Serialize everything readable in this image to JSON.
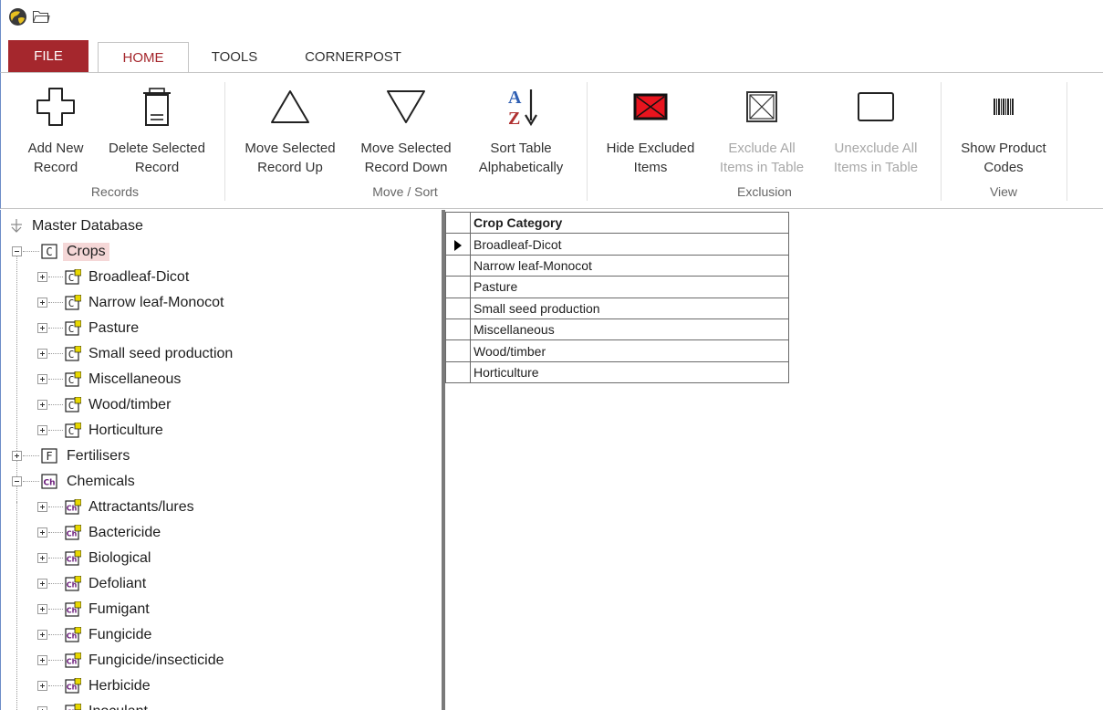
{
  "tabs": [
    {
      "id": "file",
      "label": "FILE"
    },
    {
      "id": "home",
      "label": "HOME"
    },
    {
      "id": "tools",
      "label": "TOOLS"
    },
    {
      "id": "cornerpost",
      "label": "CORNERPOST"
    }
  ],
  "ribbon": {
    "groups": [
      {
        "label": "Records"
      },
      {
        "label": "Move / Sort"
      },
      {
        "label": "Exclusion"
      },
      {
        "label": "View"
      }
    ],
    "buttons": [
      {
        "line1": "Add New",
        "line2": "Record"
      },
      {
        "line1": "Delete Selected",
        "line2": "Record"
      },
      {
        "line1": "Move Selected",
        "line2": "Record Up"
      },
      {
        "line1": "Move Selected",
        "line2": "Record Down"
      },
      {
        "line1": "Sort Table",
        "line2": "Alphabetically"
      },
      {
        "line1": "Hide Excluded",
        "line2": "Items"
      },
      {
        "line1": "Exclude All",
        "line2": "Items in Table"
      },
      {
        "line1": "Unexclude All",
        "line2": "Items in Table"
      },
      {
        "line1": "Show Product",
        "line2": "Codes"
      }
    ],
    "sort_glyph": {
      "a": "A",
      "z": "Z"
    }
  },
  "tree": {
    "root": "Master Database",
    "crops": {
      "label": "Crops",
      "icon_letter": "C",
      "children": [
        "Broadleaf-Dicot",
        "Narrow leaf-Monocot",
        "Pasture",
        "Small seed production",
        "Miscellaneous",
        "Wood/timber",
        "Horticulture"
      ]
    },
    "fertilisers": {
      "label": "Fertilisers",
      "icon_letter": "F"
    },
    "chemicals": {
      "label": "Chemicals",
      "icon_letter": "Ch",
      "children": [
        "Attractants/lures",
        "Bactericide",
        "Biological",
        "Defoliant",
        "Fumigant",
        "Fungicide",
        "Fungicide/insecticide",
        "Herbicide",
        "Inoculant"
      ]
    }
  },
  "grid": {
    "header": "Crop Category",
    "rows": [
      "Broadleaf-Dicot",
      "Narrow leaf-Monocot",
      "Pasture",
      "Small seed production",
      "Miscellaneous",
      "Wood/timber",
      "Horticulture"
    ],
    "current_row_index": 0
  },
  "colors": {
    "file_tab": "#a5272d",
    "home_tab_text": "#a5272d",
    "selected_node_bg": "#f5d7d7",
    "crop_icon": "#e8d800",
    "chem_icon": "#6a1a7a",
    "hide_excluded_red": "#e8141e"
  }
}
